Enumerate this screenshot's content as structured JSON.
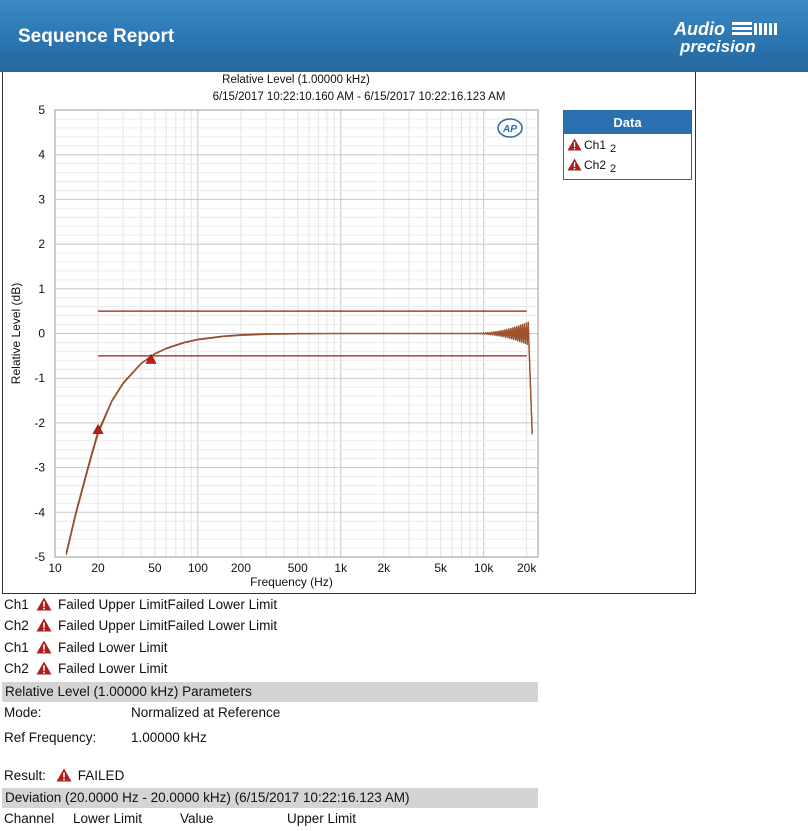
{
  "header": {
    "title": "Sequence Report",
    "logo_text": [
      "Audio",
      "precision"
    ]
  },
  "chart_data": {
    "type": "line",
    "title": "Relative Level (1.00000 kHz)",
    "subtitle": "6/15/2017 10:22:10.160 AM - 6/15/2017 10:22:16.123 AM",
    "xlabel": "Frequency (Hz)",
    "ylabel": "Relative Level (dB)",
    "x_scale": "log",
    "xlim": [
      10,
      24000
    ],
    "ylim": [
      -5,
      5
    ],
    "x_ticks": [
      {
        "value": 10,
        "label": "10"
      },
      {
        "value": 20,
        "label": "20"
      },
      {
        "value": 50,
        "label": "50"
      },
      {
        "value": 100,
        "label": "100"
      },
      {
        "value": 200,
        "label": "200"
      },
      {
        "value": 500,
        "label": "500"
      },
      {
        "value": 1000,
        "label": "1k"
      },
      {
        "value": 2000,
        "label": "2k"
      },
      {
        "value": 5000,
        "label": "5k"
      },
      {
        "value": 10000,
        "label": "10k"
      },
      {
        "value": 20000,
        "label": "20k"
      }
    ],
    "y_ticks": [
      5,
      4,
      3,
      2,
      1,
      0,
      -1,
      -2,
      -3,
      -4,
      -5
    ],
    "grid": true,
    "badge": "AP",
    "legend": {
      "title": "Data",
      "placement": "right"
    },
    "series": [
      {
        "name": "Ch1",
        "sub": "2",
        "color": "#7a3c22",
        "x": [
          12,
          14,
          16,
          18,
          20,
          25,
          30,
          40,
          50,
          60,
          80,
          100,
          150,
          200,
          300,
          500,
          1000,
          2000,
          5000,
          8000
        ],
        "y": [
          -4.9,
          -4.0,
          -3.3,
          -2.7,
          -2.2,
          -1.5,
          -1.1,
          -0.67,
          -0.45,
          -0.33,
          -0.2,
          -0.13,
          -0.06,
          -0.03,
          -0.01,
          0.0,
          0.0,
          0.0,
          0.0,
          0.0
        ]
      },
      {
        "name": "Ch2",
        "sub": "2",
        "color": "#a0522d",
        "x": [
          12,
          14,
          16,
          18,
          20,
          25,
          30,
          40,
          50,
          60,
          80,
          100,
          150,
          200,
          300,
          500,
          1000,
          2000,
          5000,
          8000
        ],
        "y": [
          -4.95,
          -4.05,
          -3.35,
          -2.75,
          -2.25,
          -1.52,
          -1.12,
          -0.68,
          -0.46,
          -0.34,
          -0.21,
          -0.14,
          -0.07,
          -0.04,
          -0.02,
          -0.01,
          0.0,
          0.0,
          0.0,
          0.0
        ]
      }
    ],
    "hf_ripple": {
      "x_start": 8000,
      "x_end": 20500,
      "max_amplitude_db": 0.25,
      "final_drop_db": -2.25
    },
    "limits": {
      "upper": {
        "x": [
          20,
          20000
        ],
        "y": 0.5
      },
      "lower": {
        "x": [
          20,
          20000
        ],
        "y": -0.5
      },
      "color": "#a01818"
    },
    "failure_markers": [
      {
        "x": 20,
        "y": -2.15
      },
      {
        "x": 47,
        "y": -0.58
      }
    ]
  },
  "results": [
    {
      "channel": "Ch1",
      "text": "Failed Upper LimitFailed Lower Limit"
    },
    {
      "channel": "Ch2",
      "text": "Failed Upper LimitFailed Lower Limit"
    },
    {
      "channel": "Ch1",
      "text": "Failed Lower Limit"
    },
    {
      "channel": "Ch2",
      "text": "Failed Lower Limit"
    }
  ],
  "parameters": {
    "heading": "Relative Level (1.00000 kHz) Parameters",
    "mode_label": "Mode:",
    "mode_value": "Normalized at Reference",
    "ref_label": "Ref Frequency:",
    "ref_value": "1.00000 kHz"
  },
  "result_summary": {
    "label": "Result:",
    "value": "FAILED"
  },
  "deviation": {
    "heading": "Deviation (20.0000 Hz - 20.0000 kHz) (6/15/2017 10:22:16.123 AM)",
    "columns": [
      "Channel",
      "Lower Limit",
      "Value",
      "Upper Limit"
    ]
  },
  "colors": {
    "header": "#2a74b0",
    "legend_header": "#2a6fb0",
    "warning": "#b01c1c",
    "section_bar": "#d4d4d4"
  }
}
